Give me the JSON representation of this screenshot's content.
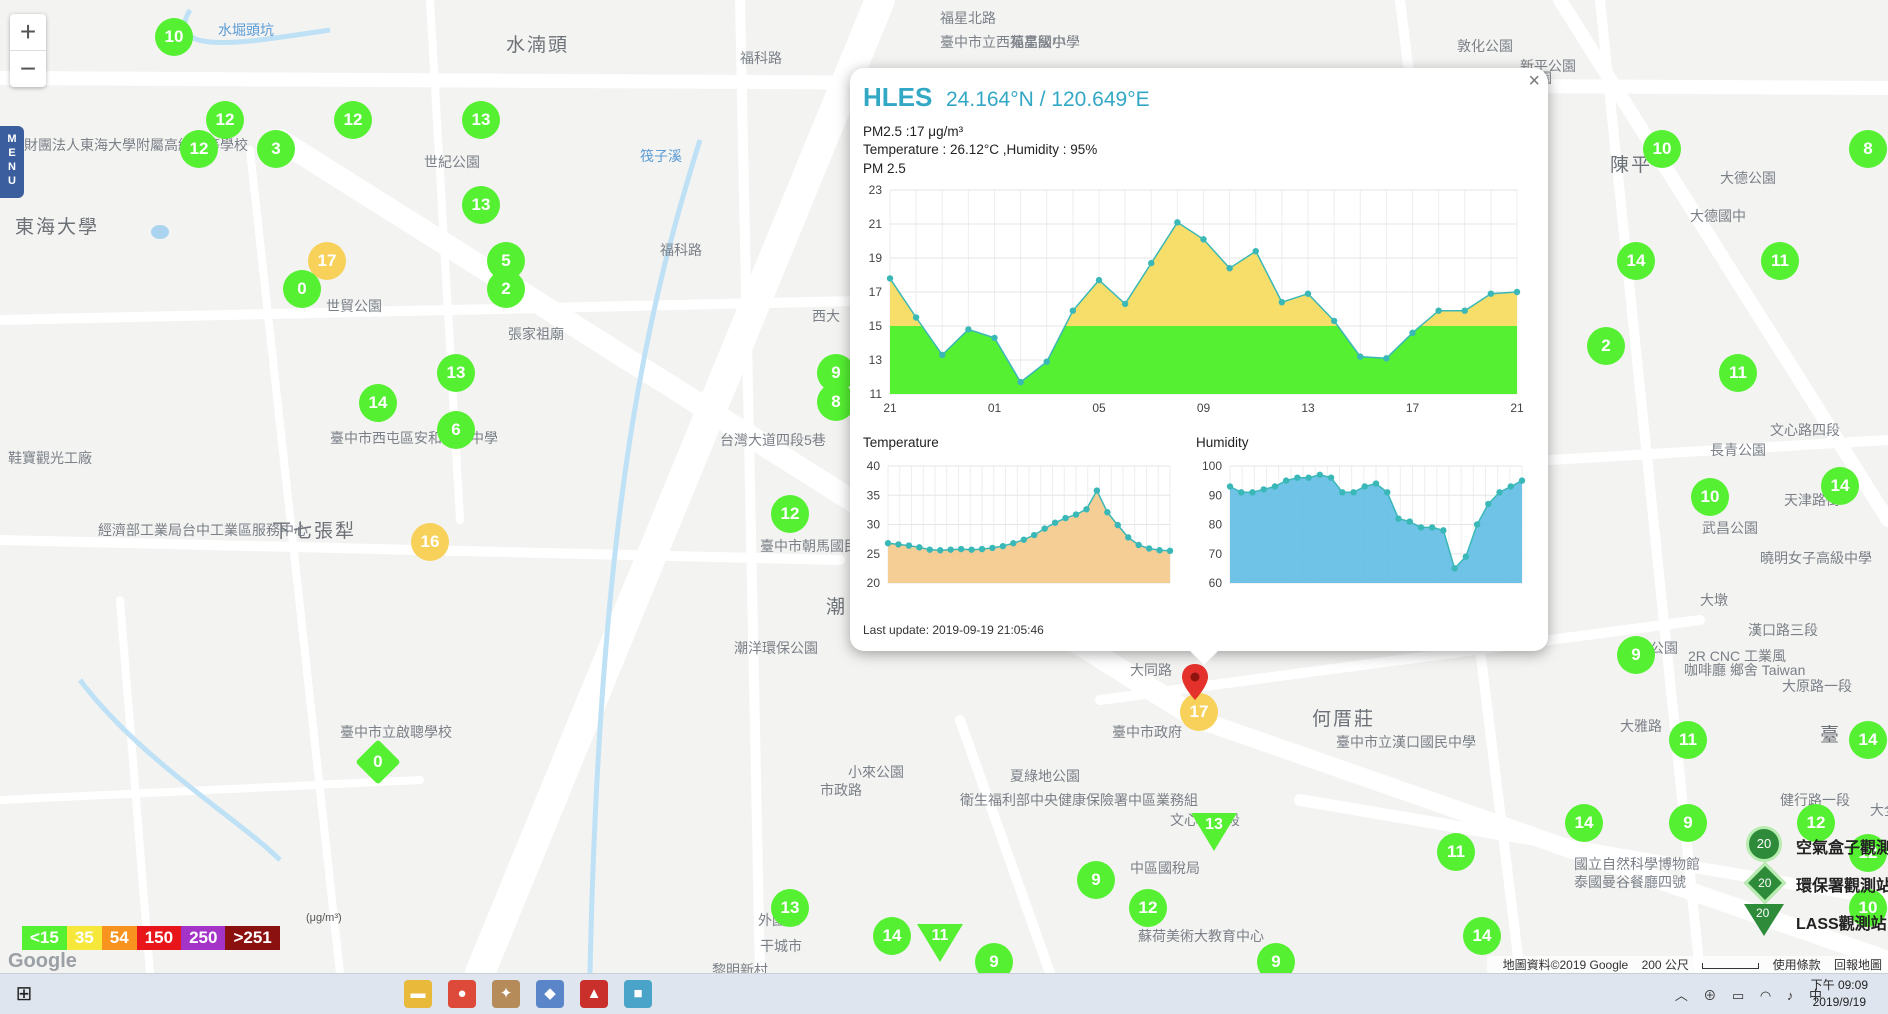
{
  "map": {
    "zoom_in": "+",
    "zoom_out": "−",
    "menu_label": "MENU",
    "google_logo": "Google",
    "attribution": {
      "map_data": "地圖資料©2019 Google",
      "scale": "200 公尺",
      "terms": "使用條款",
      "report": "回報地圖"
    },
    "places": [
      {
        "text": "水湳頭"
      },
      {
        "text": "東海大學"
      },
      {
        "text": "下七張犁"
      },
      {
        "text": "何厝莊"
      },
      {
        "text": "敦化公園"
      },
      {
        "text": "陳平公園"
      },
      {
        "text": "陳平"
      },
      {
        "text": "大德公園"
      },
      {
        "text": "大德國中"
      },
      {
        "text": "文心路四段"
      },
      {
        "text": "長青公園"
      },
      {
        "text": "武昌公園"
      },
      {
        "text": "天津路街"
      },
      {
        "text": "曉明女子高級中學"
      },
      {
        "text": "漢口路三段"
      },
      {
        "text": "華美公園"
      },
      {
        "text": "2R CNC 工業風"
      },
      {
        "text": "咖啡廳 鄉舍 Taiwan"
      },
      {
        "text": "大原路一段"
      },
      {
        "text": "臺中市立漢口國民中學"
      },
      {
        "text": "國立自然科學博物館"
      },
      {
        "text": "泰國曼谷餐廳四號"
      },
      {
        "text": "健行路一段"
      },
      {
        "text": "臺中市政府"
      },
      {
        "text": "夏綠地公園"
      },
      {
        "text": "衛生福利部中央健康保險署中區業務組"
      },
      {
        "text": "小來公園"
      },
      {
        "text": "潮洋環保公園"
      },
      {
        "text": "臺中市朝馬國民運動中心"
      },
      {
        "text": "臺中市西屯區安和國民中學"
      },
      {
        "text": "張家祖廟"
      },
      {
        "text": "世貿公園"
      },
      {
        "text": "財團法人東海大學附屬高級中等學校"
      },
      {
        "text": "臺中市立啟聰學校"
      },
      {
        "text": "經濟部工業局台中工業區服務中心"
      },
      {
        "text": "鞋寶觀光工廠"
      },
      {
        "text": "福星北路"
      },
      {
        "text": "福科路"
      },
      {
        "text": "世紀公園"
      },
      {
        "text": "福星國小"
      },
      {
        "text": "臺中市立西苑高級中學"
      },
      {
        "text": "市政路"
      },
      {
        "text": "文心路二段"
      },
      {
        "text": "福科路"
      },
      {
        "text": "新平公園"
      },
      {
        "text": "蘇荷美術大教育中心"
      },
      {
        "text": "外國家"
      },
      {
        "text": "干城市"
      },
      {
        "text": "水堀頭坑"
      },
      {
        "text": "筏子溪"
      },
      {
        "text": "台灣大道四段5巷"
      },
      {
        "text": "潮"
      },
      {
        "text": "黎明新村"
      },
      {
        "text": "中區國稅局"
      },
      {
        "text": "西大"
      },
      {
        "text": "大墩"
      },
      {
        "text": "大同路"
      },
      {
        "text": "大雅路"
      },
      {
        "text": "大全街"
      },
      {
        "text": "臺"
      }
    ],
    "markers": [
      {
        "value": "10",
        "color": "green",
        "shape": "circle"
      },
      {
        "value": "12",
        "color": "green",
        "shape": "circle"
      },
      {
        "value": "12",
        "color": "green",
        "shape": "circle"
      },
      {
        "value": "3",
        "color": "green",
        "shape": "circle"
      },
      {
        "value": "12",
        "color": "green",
        "shape": "circle"
      },
      {
        "value": "13",
        "color": "green",
        "shape": "circle"
      },
      {
        "value": "13",
        "color": "green",
        "shape": "circle"
      },
      {
        "value": "17",
        "color": "yellow",
        "shape": "circle"
      },
      {
        "value": "0",
        "color": "green",
        "shape": "circle"
      },
      {
        "value": "5",
        "color": "green",
        "shape": "circle"
      },
      {
        "value": "2",
        "color": "green",
        "shape": "circle"
      },
      {
        "value": "13",
        "color": "green",
        "shape": "circle"
      },
      {
        "value": "14",
        "color": "green",
        "shape": "circle"
      },
      {
        "value": "6",
        "color": "green",
        "shape": "circle"
      },
      {
        "value": "16",
        "color": "yellow",
        "shape": "circle"
      },
      {
        "value": "0",
        "color": "green",
        "shape": "diamond"
      },
      {
        "value": "9",
        "color": "green",
        "shape": "circle"
      },
      {
        "value": "8",
        "color": "green",
        "shape": "circle"
      },
      {
        "value": "12",
        "color": "green",
        "shape": "circle"
      },
      {
        "value": "17",
        "color": "yellow",
        "shape": "circle"
      },
      {
        "value": "13",
        "color": "green",
        "shape": "triangle"
      },
      {
        "value": "9",
        "color": "green",
        "shape": "circle"
      },
      {
        "value": "12",
        "color": "green",
        "shape": "circle"
      },
      {
        "value": "13",
        "color": "green",
        "shape": "circle"
      },
      {
        "value": "14",
        "color": "green",
        "shape": "circle"
      },
      {
        "value": "11",
        "color": "green",
        "shape": "triangle"
      },
      {
        "value": "9",
        "color": "green",
        "shape": "circle"
      },
      {
        "value": "9",
        "color": "green",
        "shape": "circle"
      },
      {
        "value": "11",
        "color": "green",
        "shape": "circle"
      },
      {
        "value": "14",
        "color": "green",
        "shape": "circle"
      },
      {
        "value": "10",
        "color": "green",
        "shape": "circle"
      },
      {
        "value": "8",
        "color": "green",
        "shape": "circle"
      },
      {
        "value": "14",
        "color": "green",
        "shape": "circle"
      },
      {
        "value": "11",
        "color": "green",
        "shape": "circle"
      },
      {
        "value": "2",
        "color": "green",
        "shape": "circle"
      },
      {
        "value": "11",
        "color": "green",
        "shape": "circle"
      },
      {
        "value": "10",
        "color": "green",
        "shape": "circle"
      },
      {
        "value": "14",
        "color": "green",
        "shape": "circle"
      },
      {
        "value": "9",
        "color": "green",
        "shape": "circle"
      },
      {
        "value": "11",
        "color": "green",
        "shape": "circle"
      },
      {
        "value": "14",
        "color": "green",
        "shape": "circle"
      },
      {
        "value": "9",
        "color": "green",
        "shape": "circle"
      },
      {
        "value": "12",
        "color": "green",
        "shape": "circle"
      },
      {
        "value": "10",
        "color": "green",
        "shape": "circle"
      },
      {
        "value": "12",
        "color": "green",
        "shape": "circle"
      },
      {
        "value": "14",
        "color": "green",
        "shape": "circle"
      }
    ],
    "aqi_legend": {
      "unit": "(μg/m³)",
      "levels": [
        {
          "label": "<15",
          "color": "#55f032"
        },
        {
          "label": "35",
          "color": "#f5e83a"
        },
        {
          "label": "54",
          "color": "#f7931e"
        },
        {
          "label": "150",
          "color": "#e8161b"
        },
        {
          "label": "250",
          "color": "#a334c7"
        },
        {
          "label": ">251",
          "color": "#8b1010"
        }
      ]
    },
    "type_legend": [
      {
        "icon": "circle",
        "value": "20",
        "label": "空氣盒子觀測"
      },
      {
        "icon": "diamond",
        "value": "20",
        "label": "環保署觀測站"
      },
      {
        "icon": "triangle",
        "value": "20",
        "label": "LASS觀測站"
      }
    ]
  },
  "popup": {
    "close": "×",
    "site": "HLES",
    "coords": "24.164°N / 120.649°E",
    "pm25_line": "PM2.5 :17 μg/m³",
    "temp_hum_line": "Temperature : 26.12°C ,Humidity : 95%",
    "pm_chart_title": "PM 2.5",
    "temp_chart_title": "Temperature",
    "hum_chart_title": "Humidity",
    "last_update": "Last update: 2019-09-19 21:05:46"
  },
  "chart_data": [
    {
      "type": "area",
      "title": "PM 2.5",
      "x_tick_labels": [
        "21",
        "01",
        "05",
        "09",
        "13",
        "17",
        "21"
      ],
      "ylim": [
        11,
        23
      ],
      "y_ticks": [
        11,
        13,
        15,
        17,
        19,
        21,
        23
      ],
      "threshold": 15,
      "colors": {
        "below": "#55f032",
        "above": "#f7dd6a",
        "line": "#3ab8b8"
      },
      "values": [
        17.8,
        15.5,
        13.3,
        14.8,
        14.3,
        11.7,
        12.9,
        15.9,
        17.7,
        16.3,
        18.7,
        21.1,
        20.1,
        18.4,
        19.4,
        16.4,
        16.9,
        15.3,
        13.2,
        13.1,
        14.6,
        15.9,
        15.9,
        16.9,
        17.0
      ],
      "grid": true
    },
    {
      "type": "area",
      "title": "Temperature",
      "ylim": [
        20,
        40
      ],
      "y_ticks": [
        20,
        25,
        30,
        35,
        40
      ],
      "colors": {
        "fill": "#f3c98a",
        "line": "#3ab8b8"
      },
      "values": [
        26.8,
        26.6,
        26.4,
        26.1,
        25.7,
        25.6,
        25.7,
        25.8,
        25.7,
        25.8,
        26.0,
        26.3,
        26.8,
        27.4,
        28.2,
        29.3,
        30.3,
        31.1,
        31.7,
        32.6,
        35.8,
        32.1,
        29.9,
        27.8,
        26.5,
        25.9,
        25.6,
        25.5
      ],
      "grid": true
    },
    {
      "type": "area",
      "title": "Humidity",
      "ylim": [
        60,
        100
      ],
      "y_ticks": [
        60,
        70,
        80,
        90,
        100
      ],
      "colors": {
        "fill": "#5fbde3",
        "line": "#3ab8b8"
      },
      "values": [
        93,
        91,
        91,
        92,
        93,
        95,
        96,
        96,
        97,
        96,
        91,
        91,
        93,
        94,
        91,
        82,
        81,
        79,
        79,
        78,
        65,
        69,
        80,
        87,
        91,
        93,
        95
      ],
      "grid": true
    }
  ],
  "taskbar": {
    "start": "⊞",
    "apps": [
      {
        "name": "file-explorer",
        "glyph": "▬",
        "color": "#e8b93a"
      },
      {
        "name": "chrome",
        "glyph": "●",
        "color": "#de4a3a"
      },
      {
        "name": "rabbit-app",
        "glyph": "✦",
        "color": "#b58b5a"
      },
      {
        "name": "paint-app",
        "glyph": "◆",
        "color": "#5a86c9"
      },
      {
        "name": "red-app",
        "glyph": "▲",
        "color": "#c9302c"
      },
      {
        "name": "blue-app",
        "glyph": "■",
        "color": "#4aa3c9"
      }
    ],
    "tray": "︿ ⊕ ▭ ◠ ♪ 中",
    "time": "下午 09:09",
    "date": "2019/9/19"
  }
}
